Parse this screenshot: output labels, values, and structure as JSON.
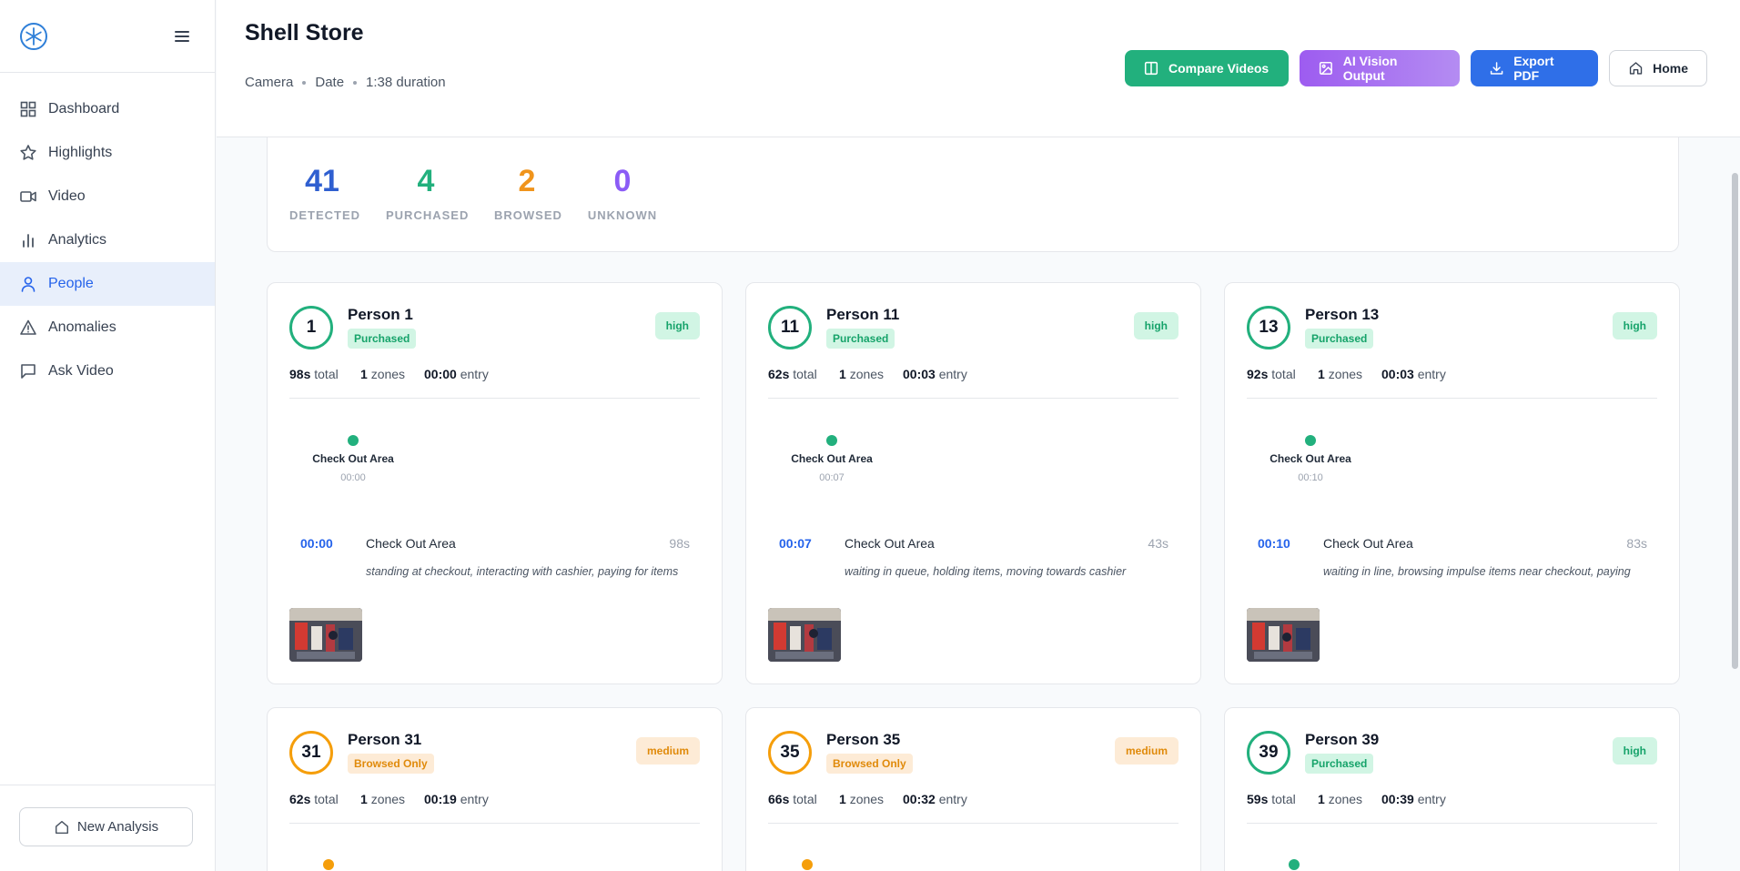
{
  "sidebar": {
    "items": [
      {
        "label": "Dashboard",
        "icon": "grid-icon"
      },
      {
        "label": "Highlights",
        "icon": "star-icon"
      },
      {
        "label": "Video",
        "icon": "video-icon"
      },
      {
        "label": "Analytics",
        "icon": "bar-chart-icon"
      },
      {
        "label": "People",
        "icon": "user-icon",
        "active": true
      },
      {
        "label": "Anomalies",
        "icon": "warning-icon"
      },
      {
        "label": "Ask Video",
        "icon": "message-icon"
      }
    ],
    "new_analysis": "New Analysis"
  },
  "header": {
    "title": "Shell Store",
    "meta": {
      "camera": "Camera",
      "date": "Date",
      "duration": "1:38 duration"
    },
    "buttons": {
      "compare": "Compare Videos",
      "ai_vision": "AI Vision Output",
      "export": "Export PDF",
      "home": "Home"
    }
  },
  "stats": [
    {
      "value": "41",
      "label": "DETECTED",
      "color": "#2f5fd0"
    },
    {
      "value": "4",
      "label": "PURCHASED",
      "color": "#22b07d"
    },
    {
      "value": "2",
      "label": "BROWSED",
      "color": "#f0941c"
    },
    {
      "value": "0",
      "label": "UNKNOWN",
      "color": "#8b5cf6"
    }
  ],
  "people": [
    {
      "num": "1",
      "name": "Person 1",
      "status": "Purchased",
      "confidence": "high",
      "total": "98s",
      "total_label": "total",
      "zones": "1",
      "zones_label": "zones",
      "entry": "00:00",
      "entry_label": "entry",
      "node_zone": "Check Out Area",
      "node_time": "00:00",
      "ev_time": "00:00",
      "ev_zone": "Check Out Area",
      "ev_dur": "98s",
      "ev_desc": "standing at checkout, interacting with cashier, paying for items"
    },
    {
      "num": "11",
      "name": "Person 11",
      "status": "Purchased",
      "confidence": "high",
      "total": "62s",
      "total_label": "total",
      "zones": "1",
      "zones_label": "zones",
      "entry": "00:03",
      "entry_label": "entry",
      "node_zone": "Check Out Area",
      "node_time": "00:07",
      "ev_time": "00:07",
      "ev_zone": "Check Out Area",
      "ev_dur": "43s",
      "ev_desc": "waiting in queue, holding items, moving towards cashier"
    },
    {
      "num": "13",
      "name": "Person 13",
      "status": "Purchased",
      "confidence": "high",
      "total": "92s",
      "total_label": "total",
      "zones": "1",
      "zones_label": "zones",
      "entry": "00:03",
      "entry_label": "entry",
      "node_zone": "Check Out Area",
      "node_time": "00:10",
      "ev_time": "00:10",
      "ev_zone": "Check Out Area",
      "ev_dur": "83s",
      "ev_desc": "waiting in line, browsing impulse items near checkout, paying"
    },
    {
      "num": "31",
      "name": "Person 31",
      "status": "Browsed Only",
      "confidence": "medium",
      "total": "62s",
      "total_label": "total",
      "zones": "1",
      "zones_label": "zones",
      "entry": "00:19",
      "entry_label": "entry"
    },
    {
      "num": "35",
      "name": "Person 35",
      "status": "Browsed Only",
      "confidence": "medium",
      "total": "66s",
      "total_label": "total",
      "zones": "1",
      "zones_label": "zones",
      "entry": "00:32",
      "entry_label": "entry"
    },
    {
      "num": "39",
      "name": "Person 39",
      "status": "Purchased",
      "confidence": "high",
      "total": "59s",
      "total_label": "total",
      "zones": "1",
      "zones_label": "zones",
      "entry": "00:39",
      "entry_label": "entry"
    }
  ]
}
